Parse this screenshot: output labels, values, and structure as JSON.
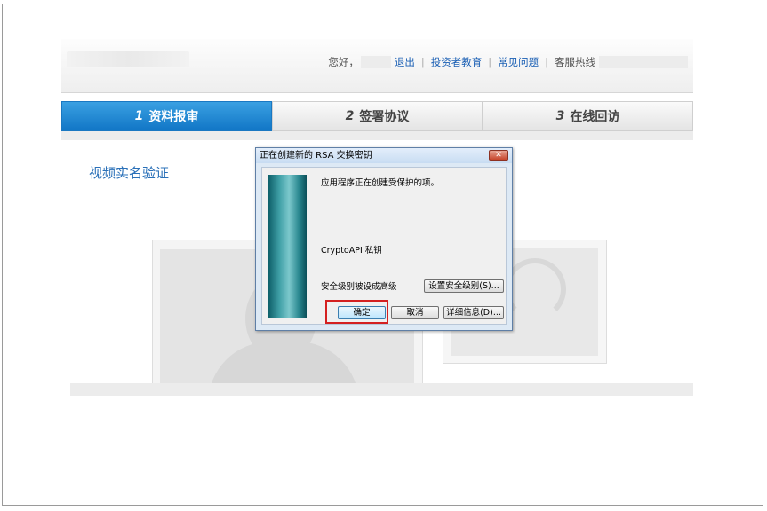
{
  "header": {
    "greeting": "您好，",
    "logout": "退出",
    "investor_education": "投资者教育",
    "faq": "常见问题",
    "hotline_label": "客服热线",
    "separator": "|"
  },
  "steps": [
    {
      "num": "1",
      "label": "资料报审"
    },
    {
      "num": "2",
      "label": "签署协议"
    },
    {
      "num": "3",
      "label": "在线回访"
    }
  ],
  "section_title": "视频实名验证",
  "dialog": {
    "title": "正在创建新的 RSA 交换密钥",
    "close_glyph": "✕",
    "message": "应用程序正在创建受保护的项。",
    "provider": "CryptoAPI 私钥",
    "security_level": "安全级别被设成高级",
    "set_level_button": "设置安全级别(S)...",
    "ok_button": "确定",
    "cancel_button": "取消",
    "details_button": "详细信息(D)..."
  },
  "colors": {
    "active_step": "#1478c5",
    "link": "#1a5fb4",
    "highlight": "#d42020"
  }
}
